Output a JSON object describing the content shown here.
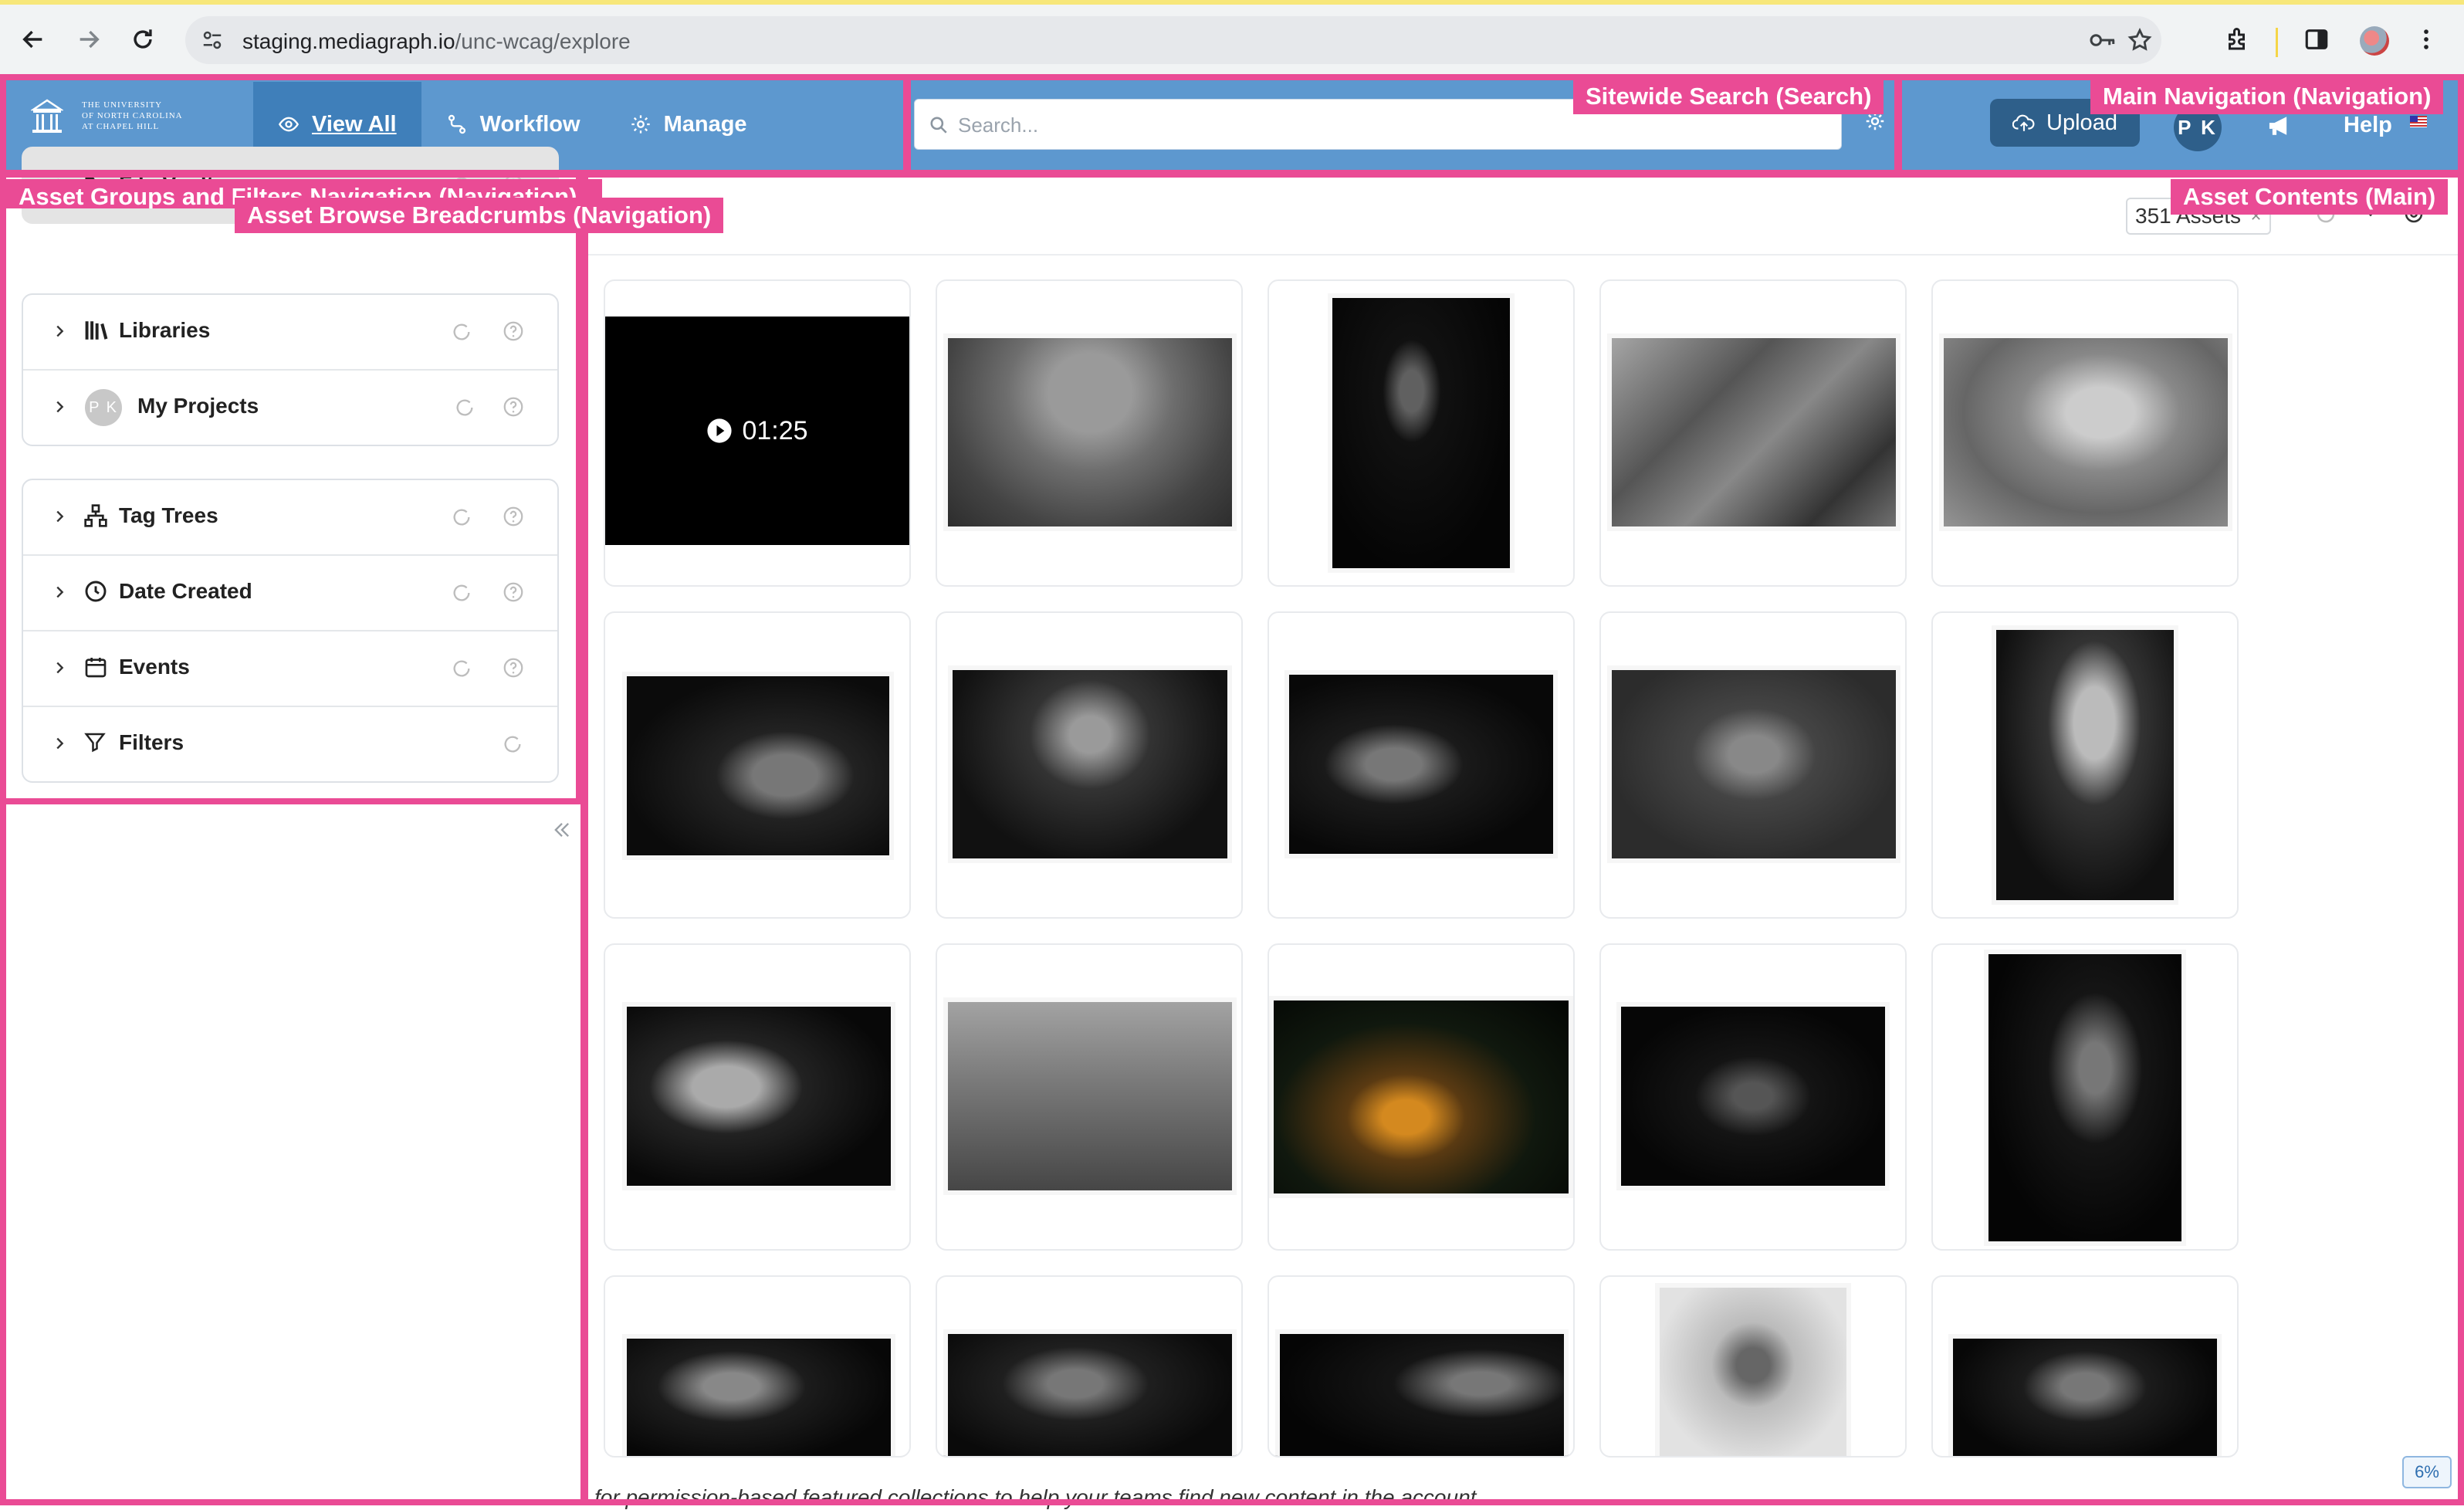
{
  "browser": {
    "url_host": "staging.mediagraph.io",
    "url_path": "/unc-wcag/explore"
  },
  "header": {
    "logo_lines": [
      "The University",
      "of North Carolina",
      "at Chapel Hill"
    ],
    "tabs": [
      {
        "label": "View All",
        "icon": "eye-icon",
        "active": true
      },
      {
        "label": "Workflow",
        "icon": "workflow-icon",
        "active": false
      },
      {
        "label": "Manage",
        "icon": "gear-icon",
        "active": false
      }
    ],
    "search_placeholder": "Search...",
    "upload_label": "Upload",
    "user_initials": "P K",
    "help_label": "Help"
  },
  "sidebar": {
    "groups": [
      [
        {
          "label": "File Vault",
          "icon": "folder-open-icon",
          "refresh": true,
          "help": true
        }
      ],
      [
        {
          "label": "Libraries",
          "icon": "libraries-icon",
          "refresh": true,
          "help": true
        },
        {
          "label": "My Projects",
          "icon": "pk-avatar",
          "badge": "P K",
          "refresh": true,
          "help": true
        }
      ],
      [
        {
          "label": "Tag Trees",
          "icon": "tag-tree-icon",
          "refresh": true,
          "help": true
        },
        {
          "label": "Date Created",
          "icon": "clock-icon",
          "refresh": true,
          "help": true
        },
        {
          "label": "Events",
          "icon": "calendar-icon",
          "refresh": true,
          "help": true
        },
        {
          "label": "Filters",
          "icon": "filter-icon",
          "refresh": true,
          "help": false
        }
      ]
    ]
  },
  "main": {
    "asset_count_label": "351 Assets",
    "video_duration": "01:25",
    "zoom": "6%",
    "behind_text": "for permission-based featured collections to help your teams find new content in the account."
  },
  "overlay_labels": {
    "sitewide_search": "Sitewide Search (Search)",
    "main_navigation": "Main Navigation (Navigation)",
    "asset_groups": "Asset Groups and Filters Navigation (Navigation)",
    "breadcrumbs": "Asset Browse Breadcrumbs (Navigation)",
    "asset_contents": "Asset Contents (Main)"
  },
  "colors": {
    "header_bg": "#5d98cf",
    "active_tab": "#3f7fba",
    "upload_bg": "#2e5f8a",
    "overlay": "#ea4b95"
  }
}
